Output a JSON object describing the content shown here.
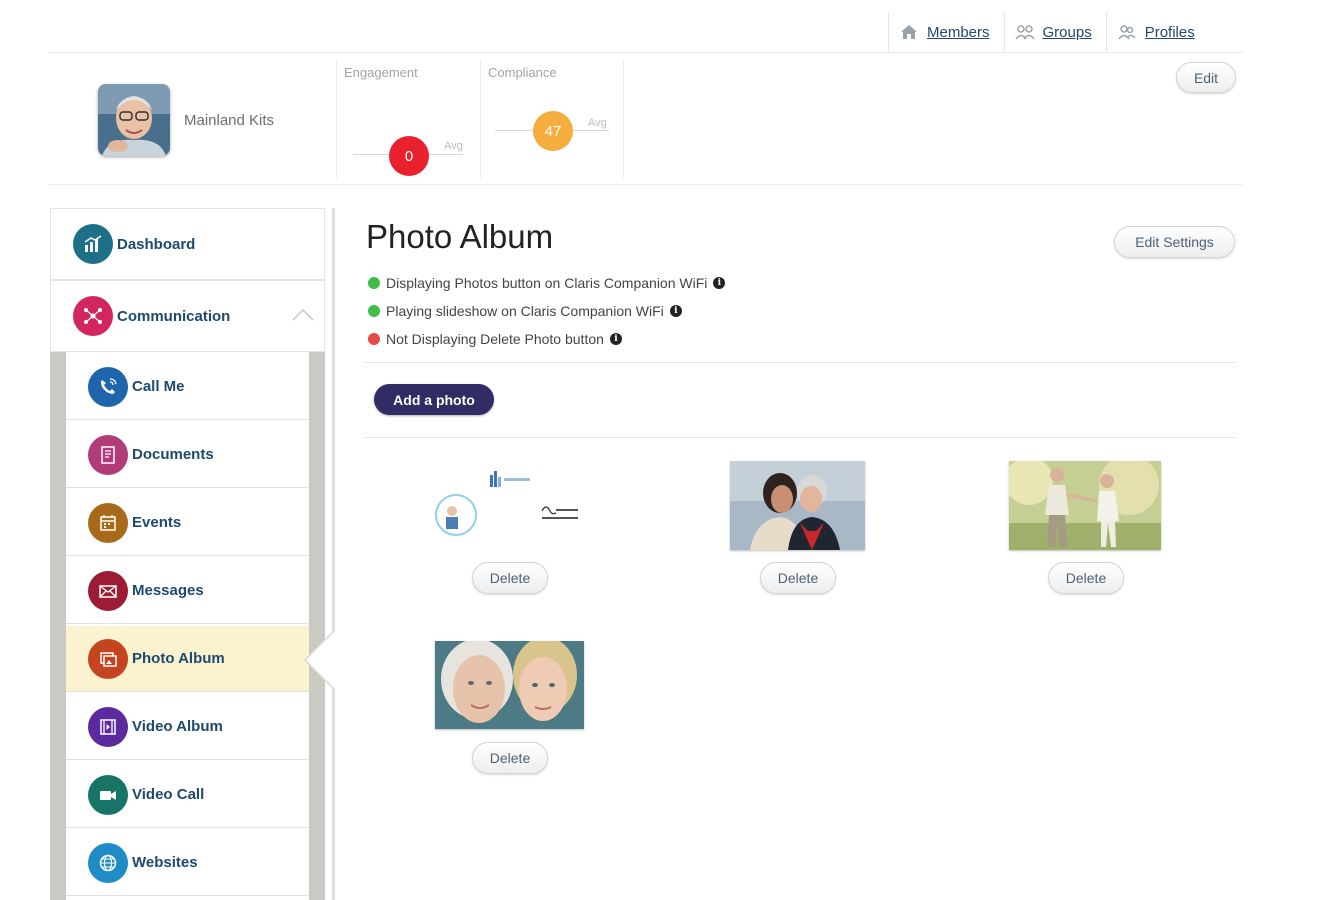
{
  "topnav": {
    "items": [
      {
        "label": "Members",
        "icon": "home-icon"
      },
      {
        "label": "Groups",
        "icon": "groups-icon"
      },
      {
        "label": "Profiles",
        "icon": "profiles-icon"
      }
    ]
  },
  "header": {
    "member_name": "Mainland Kits",
    "edit_label": "Edit",
    "metrics": [
      {
        "label": "Engagement",
        "value": "0",
        "avg_label": "Avg",
        "color": "#e8212e"
      },
      {
        "label": "Compliance",
        "value": "47",
        "avg_label": "Avg",
        "color": "#f5ad3d"
      }
    ]
  },
  "sidebar": {
    "top": [
      {
        "label": "Dashboard",
        "icon": "dashboard-icon",
        "color": "#1e6f88"
      },
      {
        "label": "Communication",
        "icon": "communication-icon",
        "color": "#d2265e"
      }
    ],
    "items": [
      {
        "label": "Call Me",
        "icon": "phone-icon",
        "color": "#1f65ad"
      },
      {
        "label": "Documents",
        "icon": "documents-icon",
        "color": "#b23b79"
      },
      {
        "label": "Events",
        "icon": "calendar-icon",
        "color": "#a86a18"
      },
      {
        "label": "Messages",
        "icon": "envelope-icon",
        "color": "#9b1c34"
      },
      {
        "label": "Photo Album",
        "icon": "photo-icon",
        "color": "#c3441e"
      },
      {
        "label": "Video Album",
        "icon": "film-icon",
        "color": "#5b2a9e"
      },
      {
        "label": "Video Call",
        "icon": "video-camera-icon",
        "color": "#197468"
      },
      {
        "label": "Websites",
        "icon": "globe-icon",
        "color": "#1f8bc7"
      }
    ]
  },
  "main": {
    "title": "Photo Album",
    "edit_settings_label": "Edit Settings",
    "statuses": [
      {
        "text": "Displaying Photos button on Claris Companion WiFi",
        "color": "#3fbf4a"
      },
      {
        "text": "Playing slideshow on Claris Companion WiFi",
        "color": "#3fbf4a"
      },
      {
        "text": "Not Displaying Delete Photo button",
        "color": "#e44a4a"
      }
    ],
    "add_photo_label": "Add a photo",
    "delete_label": "Delete"
  }
}
